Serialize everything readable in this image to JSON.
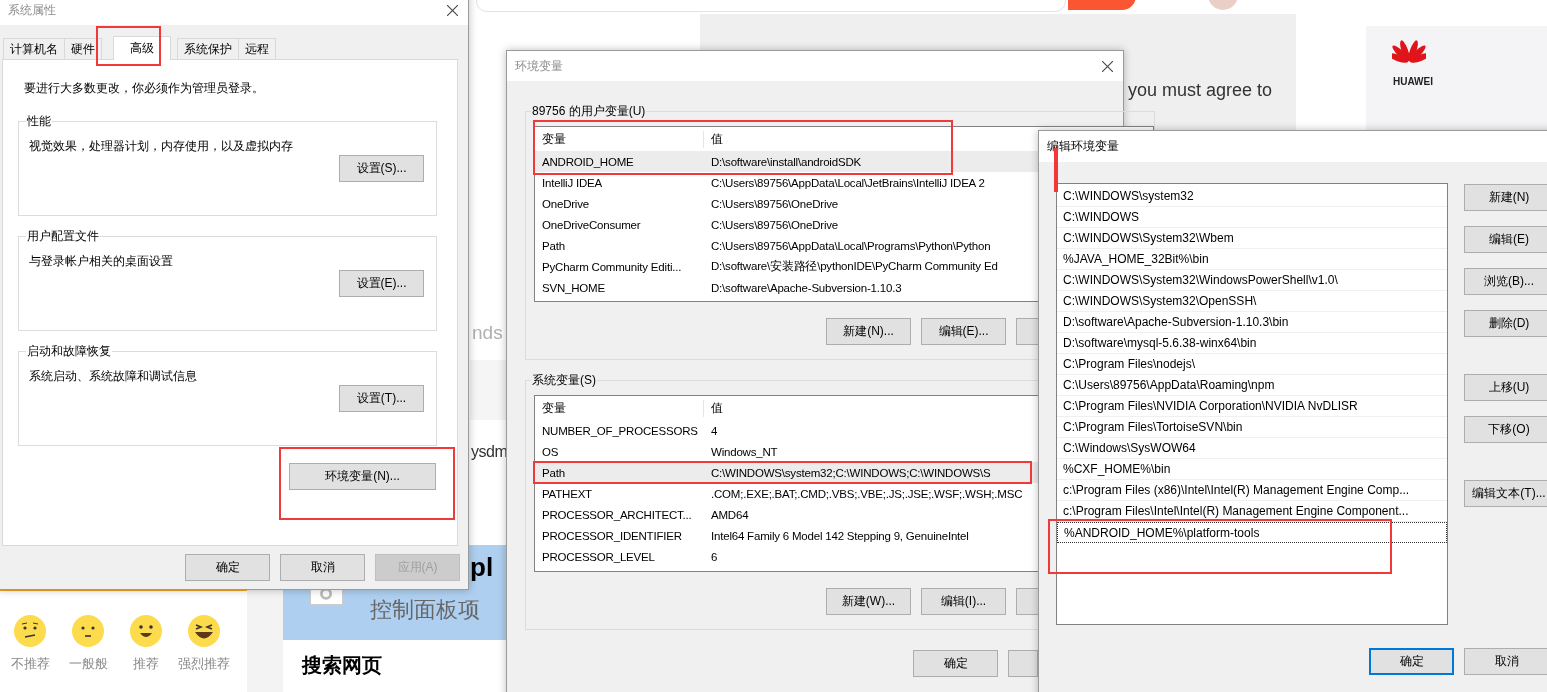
{
  "background_page": {
    "agree_text": "you must agree to",
    "logo_text": "HUAWEI",
    "fragment_top": "nds",
    "fragment_middle": "ysdm",
    "fragment_banner": "pl",
    "banner_title": "控制面板项",
    "search_heading": "搜索网页",
    "ratings": [
      {
        "kind": "confused",
        "label": "不推荐"
      },
      {
        "kind": "neutral",
        "label": "一般般"
      },
      {
        "kind": "smile",
        "label": "推荐"
      },
      {
        "kind": "laugh",
        "label": "强烈推荐"
      }
    ]
  },
  "system_properties": {
    "title": "系统属性",
    "tabs": [
      {
        "label": "计算机名",
        "selected": false
      },
      {
        "label": "硬件",
        "selected": false
      },
      {
        "label": "高级",
        "selected": true
      },
      {
        "label": "系统保护",
        "selected": false
      },
      {
        "label": "远程",
        "selected": false
      }
    ],
    "notice": "要进行大多数更改，你必须作为管理员登录。",
    "groups": [
      {
        "title": "性能",
        "description": "视觉效果，处理器计划，内存使用，以及虚拟内存",
        "button": "设置(S)..."
      },
      {
        "title": "用户配置文件",
        "description": "与登录帐户相关的桌面设置",
        "button": "设置(E)..."
      },
      {
        "title": "启动和故障恢复",
        "description": "系统启动、系统故障和调试信息",
        "button": "设置(T)..."
      }
    ],
    "env_button": "环境变量(N)...",
    "buttons": [
      {
        "label": "确定",
        "disabled": false
      },
      {
        "label": "取消",
        "disabled": false
      },
      {
        "label": "应用(A)",
        "disabled": true
      }
    ]
  },
  "environment_variables": {
    "title": "环境变量",
    "user_section": {
      "label": "89756 的用户变量(U)",
      "columns": [
        "变量",
        "值"
      ],
      "rows": [
        {
          "name": "ANDROID_HOME",
          "value": "D:\\software\\install\\androidSDK",
          "selected": true
        },
        {
          "name": "IntelliJ IDEA",
          "value": "C:\\Users\\89756\\AppData\\Local\\JetBrains\\IntelliJ IDEA 2",
          "selected": false
        },
        {
          "name": "OneDrive",
          "value": "C:\\Users\\89756\\OneDrive",
          "selected": false
        },
        {
          "name": "OneDriveConsumer",
          "value": "C:\\Users\\89756\\OneDrive",
          "selected": false
        },
        {
          "name": "Path",
          "value": "C:\\Users\\89756\\AppData\\Local\\Programs\\Python\\Python",
          "selected": false
        },
        {
          "name": "PyCharm Community Editi...",
          "value": "D:\\software\\安装路径\\pythonIDE\\PyCharm Community Ed",
          "selected": false
        },
        {
          "name": "SVN_HOME",
          "value": "D:\\software\\Apache-Subversion-1.10.3",
          "selected": false
        }
      ],
      "buttons": [
        "新建(N)...",
        "编辑(E)..."
      ]
    },
    "system_section": {
      "label": "系统变量(S)",
      "columns": [
        "变量",
        "值"
      ],
      "rows": [
        {
          "name": "NUMBER_OF_PROCESSORS",
          "value": "4",
          "selected": false
        },
        {
          "name": "OS",
          "value": "Windows_NT",
          "selected": false
        },
        {
          "name": "Path",
          "value": "C:\\WINDOWS\\system32;C:\\WINDOWS;C:\\WINDOWS\\S",
          "selected": true
        },
        {
          "name": "PATHEXT",
          "value": ".COM;.EXE;.BAT;.CMD;.VBS;.VBE;.JS;.JSE;.WSF;.WSH;.MSC",
          "selected": false
        },
        {
          "name": "PROCESSOR_ARCHITECT...",
          "value": "AMD64",
          "selected": false
        },
        {
          "name": "PROCESSOR_IDENTIFIER",
          "value": "Intel64 Family 6 Model 142 Stepping 9, GenuineIntel",
          "selected": false
        },
        {
          "name": "PROCESSOR_LEVEL",
          "value": "6",
          "selected": false
        }
      ],
      "buttons": [
        "新建(W)...",
        "编辑(I)..."
      ]
    },
    "buttons": [
      "确定"
    ]
  },
  "edit_variable": {
    "title": "编辑环境变量",
    "entries": [
      {
        "text": "C:\\WINDOWS\\system32",
        "selected": false
      },
      {
        "text": "C:\\WINDOWS",
        "selected": false
      },
      {
        "text": "C:\\WINDOWS\\System32\\Wbem",
        "selected": false
      },
      {
        "text": "%JAVA_HOME_32Bit%\\bin",
        "selected": false
      },
      {
        "text": "C:\\WINDOWS\\System32\\WindowsPowerShell\\v1.0\\",
        "selected": false
      },
      {
        "text": "C:\\WINDOWS\\System32\\OpenSSH\\",
        "selected": false
      },
      {
        "text": "D:\\software\\Apache-Subversion-1.10.3\\bin",
        "selected": false
      },
      {
        "text": "D:\\software\\mysql-5.6.38-winx64\\bin",
        "selected": false
      },
      {
        "text": "C:\\Program Files\\nodejs\\",
        "selected": false
      },
      {
        "text": "C:\\Users\\89756\\AppData\\Roaming\\npm",
        "selected": false
      },
      {
        "text": "C:\\Program Files\\NVIDIA Corporation\\NVIDIA NvDLISR",
        "selected": false
      },
      {
        "text": "C:\\Program Files\\TortoiseSVN\\bin",
        "selected": false
      },
      {
        "text": "C:\\Windows\\SysWOW64",
        "selected": false
      },
      {
        "text": "%CXF_HOME%\\bin",
        "selected": false
      },
      {
        "text": "c:\\Program Files (x86)\\Intel\\Intel(R) Management Engine Comp...",
        "selected": false
      },
      {
        "text": "c:\\Program Files\\Intel\\Intel(R) Management Engine Component...",
        "selected": false
      },
      {
        "text": "%ANDROID_HOME%\\platform-tools",
        "selected": true
      }
    ],
    "button_groups": [
      {
        "buttons": [
          "新建(N)",
          "编辑(E)",
          "浏览(B)...",
          "删除(D)"
        ]
      },
      {
        "buttons": [
          "上移(U)",
          "下移(O)"
        ]
      },
      {
        "buttons": [
          "编辑文本(T)..."
        ]
      }
    ],
    "footer_buttons": [
      {
        "label": "确定",
        "default": true
      },
      {
        "label": "取消",
        "default": false
      }
    ]
  }
}
